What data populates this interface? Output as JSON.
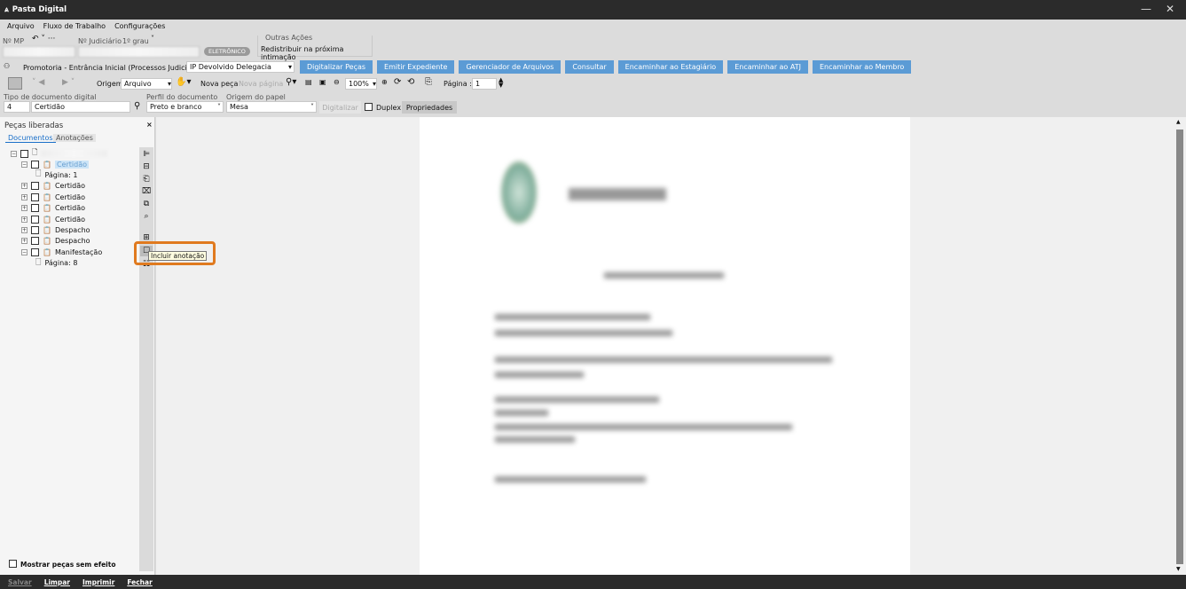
{
  "window": {
    "title": "Pasta Digital",
    "icon": "app-logo-icon"
  },
  "menu": [
    "Arquivo",
    "Fluxo de Trabalho",
    "Configurações"
  ],
  "header": {
    "mp_label": "Nº MP",
    "judiciario_label": "Nº Judiciário",
    "grau": "1º grau",
    "badge": "ELETRÔNICO",
    "outras_acoes_label": "Outras Ações",
    "outras_acoes_item": "Redistribuir na próxima intimação"
  },
  "queue": {
    "label": "Promotoria - Entrância Inicial (Processos Judiciais) - Fila",
    "value": "IP Devolvido Delegacia"
  },
  "actions": [
    "Digitalizar Peças",
    "Emitir Expediente",
    "Gerenciador de Arquivos",
    "Consultar",
    "Encaminhar ao Estagiário",
    "Encaminhar ao ATJ",
    "Encaminhar ao Membro"
  ],
  "toolbar": {
    "origem_label": "Origem",
    "origem_value": "Arquivo",
    "nova_peca": "Nova peça",
    "nova_pagina": "Nova página",
    "zoom": "100%",
    "pagina_label": "Página :",
    "pagina_value": "1"
  },
  "form": {
    "tipo_label": "Tipo de documento digital",
    "tipo_code": "4",
    "tipo_value": "Certidão",
    "perfil_label": "Perfil do documento",
    "perfil_value": "Preto e branco",
    "origem_papel_label": "Origem do papel",
    "origem_papel_value": "Mesa",
    "digitalizar": "Digitalizar",
    "duplex": "Duplex",
    "propriedades": "Propriedades"
  },
  "panel": {
    "title": "Peças liberadas",
    "tabs": [
      "Documentos",
      "Anotações"
    ],
    "tree": [
      {
        "label": "Certidão",
        "selected": true,
        "child": "Página: 1"
      },
      {
        "label": "Certidão"
      },
      {
        "label": "Certidão"
      },
      {
        "label": "Certidão"
      },
      {
        "label": "Certidão"
      },
      {
        "label": "Despacho"
      },
      {
        "label": "Despacho"
      },
      {
        "label": "Manifestação",
        "child": "Página: 8"
      }
    ],
    "show_no_effect": "Mostrar peças sem efeito"
  },
  "tooltip": "Incluir anotação",
  "highlight_color": "#e07a1f",
  "accent": "#5b9bd5",
  "bottom": [
    "Salvar",
    "Limpar",
    "Imprimir",
    "Fechar"
  ]
}
